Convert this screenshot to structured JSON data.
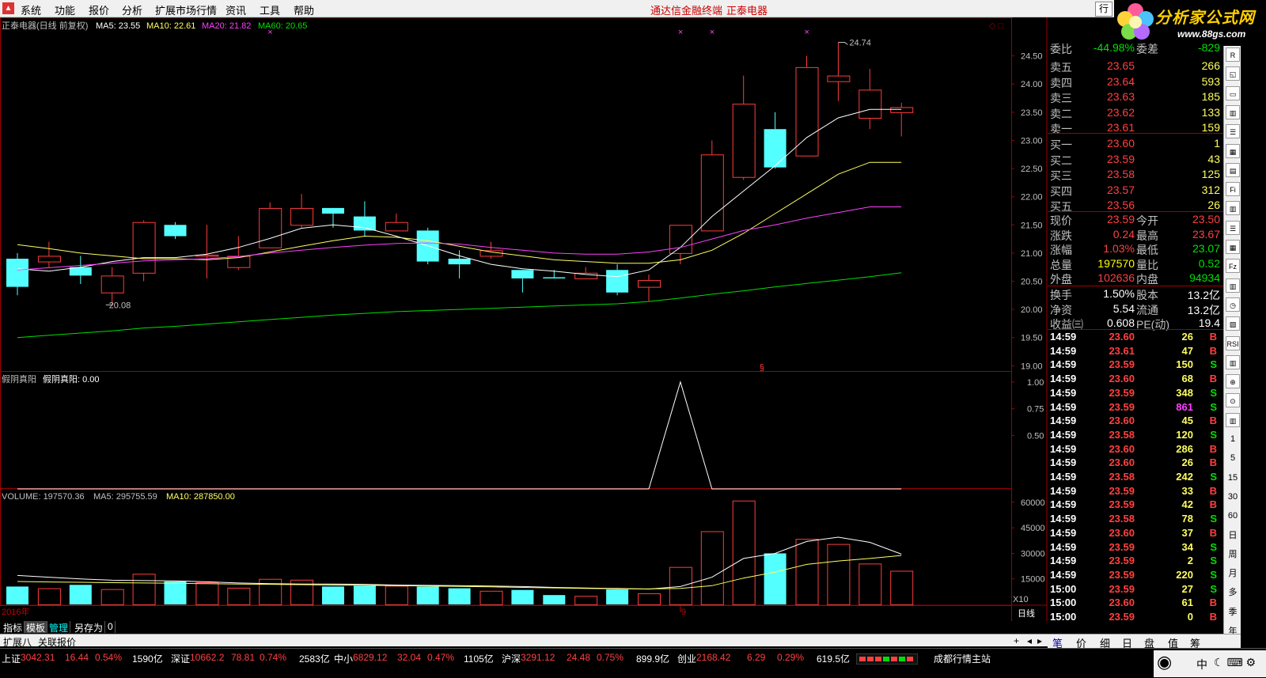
{
  "menu": {
    "items": [
      "系统",
      "功能",
      "报价",
      "分析",
      "扩展市场行情",
      "资讯",
      "工具",
      "帮助"
    ],
    "center_title": "通达信金融终端",
    "center_stock": "正泰电器",
    "win_tab": "行"
  },
  "brand": {
    "name": "分析家公式网",
    "url": "www.88gs.com"
  },
  "main_legend": {
    "title": "正泰电器(日线 前复权)",
    "ma5": "MA5: 23.55",
    "ma10": "MA10: 22.61",
    "ma20": "MA20: 21.82",
    "ma60": "MA60: 20.65"
  },
  "price_axis": [
    "24.50",
    "24.00",
    "23.50",
    "23.00",
    "22.50",
    "22.00",
    "21.50",
    "21.00",
    "20.50",
    "20.00",
    "19.50",
    "19.00"
  ],
  "annotations": {
    "high": "24.74",
    "low": "20.08"
  },
  "indicator": {
    "title": "假阴真阳",
    "label": "假阴真阳: 0.00",
    "axis": [
      "1.00",
      "0.75",
      "0.50"
    ]
  },
  "volume_legend": {
    "volume": "VOLUME: 197570.36",
    "ma5": "MA5: 295755.59",
    "ma10": "MA10: 287850.00"
  },
  "volume_axis": [
    "60000",
    "45000",
    "30000",
    "15000"
  ],
  "volume_unit": "X10",
  "date_axis": {
    "year": "2016年",
    "month": "9",
    "period": "日线"
  },
  "chart_data": {
    "type": "candlestick",
    "ohlc": [
      [
        20.9,
        20.4,
        21.0,
        20.25
      ],
      [
        20.85,
        20.95,
        21.2,
        20.75
      ],
      [
        20.75,
        20.6,
        20.95,
        20.45
      ],
      [
        20.3,
        20.6,
        20.75,
        20.08
      ],
      [
        20.65,
        21.55,
        21.58,
        20.5
      ],
      [
        21.5,
        21.3,
        21.55,
        21.25
      ],
      [
        20.95,
        20.97,
        21.5,
        20.55
      ],
      [
        20.75,
        20.95,
        21.3,
        20.7
      ],
      [
        21.1,
        21.8,
        21.9,
        21.1
      ],
      [
        21.5,
        21.8,
        22.05,
        21.45
      ],
      [
        21.8,
        21.7,
        21.78,
        21.45
      ],
      [
        21.65,
        21.4,
        21.92,
        21.3
      ],
      [
        21.4,
        21.55,
        21.7,
        21.4
      ],
      [
        21.4,
        20.85,
        21.45,
        20.8
      ],
      [
        20.9,
        20.8,
        21.05,
        20.55
      ],
      [
        20.95,
        21.05,
        21.2,
        20.9
      ],
      [
        20.7,
        20.55,
        20.7,
        20.3
      ],
      [
        20.57,
        20.55,
        20.7,
        20.55
      ],
      [
        20.55,
        20.65,
        20.75,
        20.55
      ],
      [
        20.7,
        20.3,
        20.8,
        20.25
      ],
      [
        20.4,
        20.52,
        20.62,
        20.15
      ],
      [
        21.0,
        21.5,
        21.5,
        20.8
      ],
      [
        21.4,
        22.75,
        23.0,
        21.4
      ],
      [
        22.35,
        23.65,
        24.15,
        22.3
      ],
      [
        23.2,
        22.52,
        23.5,
        22.5
      ],
      [
        22.73,
        24.3,
        24.5,
        22.73
      ],
      [
        24.05,
        24.15,
        24.74,
        23.7
      ],
      [
        23.4,
        23.9,
        24.27,
        23.2
      ],
      [
        23.5,
        23.59,
        23.67,
        23.07
      ]
    ],
    "ma5": [
      20.72,
      20.68,
      20.75,
      20.85,
      20.92,
      20.92,
      20.98,
      21.1,
      21.26,
      21.44,
      21.5,
      21.45,
      21.3,
      21.13,
      20.95,
      20.8,
      20.72,
      20.68,
      20.62,
      20.58,
      20.7,
      21.1,
      21.65,
      22.1,
      22.55,
      23.05,
      23.4,
      23.55,
      23.55
    ],
    "ma10": [
      21.15,
      21.08,
      21.0,
      20.95,
      20.9,
      20.9,
      20.88,
      20.92,
      21.02,
      21.12,
      21.22,
      21.3,
      21.28,
      21.22,
      21.12,
      21.02,
      20.95,
      20.88,
      20.85,
      20.82,
      20.82,
      20.88,
      21.05,
      21.35,
      21.7,
      22.05,
      22.4,
      22.61,
      22.61
    ],
    "ma20": [
      20.7,
      20.74,
      20.78,
      20.82,
      20.86,
      20.88,
      20.9,
      20.94,
      21.0,
      21.05,
      21.1,
      21.14,
      21.17,
      21.18,
      21.16,
      21.1,
      21.05,
      21.0,
      20.98,
      20.98,
      21.02,
      21.1,
      21.25,
      21.4,
      21.5,
      21.62,
      21.72,
      21.82,
      21.82
    ],
    "ma60": [
      19.5,
      19.54,
      19.58,
      19.62,
      19.67,
      19.7,
      19.74,
      19.78,
      19.82,
      19.86,
      19.9,
      19.93,
      19.96,
      19.98,
      20.0,
      20.02,
      20.04,
      20.06,
      20.08,
      20.1,
      20.14,
      20.2,
      20.27,
      20.33,
      20.4,
      20.46,
      20.52,
      20.58,
      20.65
    ],
    "indicator": [
      0,
      0,
      0,
      0,
      0,
      0,
      0,
      0,
      0,
      0,
      0,
      0,
      0,
      0,
      0,
      0,
      0,
      0,
      0,
      0,
      0,
      1,
      0,
      0,
      0,
      0,
      0,
      0,
      0
    ],
    "volume": [
      10500,
      9500,
      11500,
      9000,
      18000,
      13500,
      13000,
      9800,
      15000,
      14500,
      10500,
      11000,
      11000,
      10500,
      9500,
      8000,
      8500,
      5500,
      5000,
      8800,
      6500,
      22000,
      43000,
      61000,
      30000,
      38500,
      35500,
      24000,
      19757
    ],
    "vol_ma5": [
      17000,
      16000,
      15000,
      14200,
      14000,
      13800,
      13300,
      12600,
      12200,
      12000,
      12000,
      11800,
      11400,
      11200,
      11000,
      10800,
      10500,
      10000,
      9600,
      9400,
      9000,
      10500,
      16000,
      27000,
      30000,
      37000,
      39500,
      36500,
      29575
    ],
    "vol_ma10": [
      13500,
      13200,
      13000,
      12800,
      12600,
      12400,
      12200,
      12000,
      11800,
      11600,
      11400,
      11200,
      11000,
      10800,
      10600,
      10300,
      10000,
      9700,
      9400,
      9200,
      9100,
      9400,
      11000,
      15500,
      19000,
      23500,
      25500,
      27000,
      28785
    ],
    "price_range": [
      18.92,
      24.86
    ],
    "vol_range": [
      0,
      66000
    ]
  },
  "quote": {
    "wei": {
      "label": "委比",
      "value": "-44.98%",
      "label2": "委差",
      "value2": "-829"
    },
    "sells": [
      {
        "label": "卖五",
        "price": "23.65",
        "vol": "266"
      },
      {
        "label": "卖四",
        "price": "23.64",
        "vol": "593"
      },
      {
        "label": "卖三",
        "price": "23.63",
        "vol": "185"
      },
      {
        "label": "卖二",
        "price": "23.62",
        "vol": "133"
      },
      {
        "label": "卖一",
        "price": "23.61",
        "vol": "159"
      }
    ],
    "buys": [
      {
        "label": "买一",
        "price": "23.60",
        "vol": "1"
      },
      {
        "label": "买二",
        "price": "23.59",
        "vol": "43"
      },
      {
        "label": "买三",
        "price": "23.58",
        "vol": "125"
      },
      {
        "label": "买四",
        "price": "23.57",
        "vol": "312"
      },
      {
        "label": "买五",
        "price": "23.56",
        "vol": "26"
      }
    ],
    "stats": [
      {
        "l1": "现价",
        "v1": "23.59",
        "c1": "#ff4040",
        "l2": "今开",
        "v2": "23.50",
        "c2": "#ff4040"
      },
      {
        "l1": "涨跌",
        "v1": "0.24",
        "c1": "#ff4040",
        "l2": "最高",
        "v2": "23.67",
        "c2": "#ff4040"
      },
      {
        "l1": "涨幅",
        "v1": "1.03%",
        "c1": "#ff4040",
        "l2": "最低",
        "v2": "23.07",
        "c2": "#00e000"
      },
      {
        "l1": "总量",
        "v1": "197570",
        "c1": "#ffff00",
        "l2": "量比",
        "v2": "0.52",
        "c2": "#00e000"
      },
      {
        "l1": "外盘",
        "v1": "102636",
        "c1": "#ff4040",
        "l2": "内盘",
        "v2": "94934",
        "c2": "#00e000"
      }
    ],
    "fund": [
      {
        "l1": "换手",
        "v1": "1.50%",
        "l2": "股本",
        "v2": "13.2亿"
      },
      {
        "l1": "净资",
        "v1": "5.54",
        "l2": "流通",
        "v2": "13.2亿"
      },
      {
        "l1": "收益㈢",
        "v1": "0.608",
        "l2": "PE(动)",
        "v2": "19.4"
      }
    ]
  },
  "ticks": [
    {
      "t": "14:59",
      "p": "23.60",
      "v": "26",
      "d": "B"
    },
    {
      "t": "14:59",
      "p": "23.61",
      "v": "47",
      "d": "B"
    },
    {
      "t": "14:59",
      "p": "23.59",
      "v": "150",
      "d": "S"
    },
    {
      "t": "14:59",
      "p": "23.60",
      "v": "68",
      "d": "B"
    },
    {
      "t": "14:59",
      "p": "23.59",
      "v": "348",
      "d": "S"
    },
    {
      "t": "14:59",
      "p": "23.59",
      "v": "861",
      "d": "S"
    },
    {
      "t": "14:59",
      "p": "23.60",
      "v": "45",
      "d": "B"
    },
    {
      "t": "14:59",
      "p": "23.58",
      "v": "120",
      "d": "S"
    },
    {
      "t": "14:59",
      "p": "23.60",
      "v": "286",
      "d": "B"
    },
    {
      "t": "14:59",
      "p": "23.60",
      "v": "26",
      "d": "B"
    },
    {
      "t": "14:59",
      "p": "23.58",
      "v": "242",
      "d": "S"
    },
    {
      "t": "14:59",
      "p": "23.59",
      "v": "33",
      "d": "B"
    },
    {
      "t": "14:59",
      "p": "23.59",
      "v": "42",
      "d": "B"
    },
    {
      "t": "14:59",
      "p": "23.58",
      "v": "78",
      "d": "S"
    },
    {
      "t": "14:59",
      "p": "23.60",
      "v": "37",
      "d": "B"
    },
    {
      "t": "14:59",
      "p": "23.59",
      "v": "34",
      "d": "S"
    },
    {
      "t": "14:59",
      "p": "23.59",
      "v": "2",
      "d": "S"
    },
    {
      "t": "14:59",
      "p": "23.59",
      "v": "220",
      "d": "S"
    },
    {
      "t": "15:00",
      "p": "23.59",
      "v": "27",
      "d": "S"
    },
    {
      "t": "15:00",
      "p": "23.60",
      "v": "61",
      "d": "B"
    },
    {
      "t": "15:00",
      "p": "23.59",
      "v": "0",
      "d": "B"
    }
  ],
  "right_tools": [
    "R",
    "◱",
    "▭",
    "▥",
    "☰",
    "▦",
    "▤",
    "Fi",
    "▥",
    "☰",
    "▦",
    "Fz",
    "▥",
    "◷",
    "▨",
    "RSI",
    "▥",
    "⊕",
    "⊙",
    "▥",
    "1",
    "5",
    "15",
    "30",
    "60",
    "日",
    "周",
    "月",
    "多",
    "季",
    "年"
  ],
  "bottom_tabs": [
    "指标",
    "模板",
    "管理",
    "另存为",
    "0"
  ],
  "ext_tabs": [
    "扩展八",
    "关联报价"
  ],
  "ext_controls": [
    "+",
    "◂",
    "▸"
  ],
  "quote_tabs": [
    "笔",
    "价",
    "细",
    "日",
    "盘",
    "值",
    "筹"
  ],
  "status": {
    "sh": {
      "name": "上证",
      "idx": "3042.31",
      "chg": "16.44",
      "pct": "0.54%",
      "amt": "1590亿"
    },
    "sz": {
      "name": "深证",
      "idx": "10662.2",
      "chg": "78.81",
      "pct": "0.74%",
      "amt": "2583亿"
    },
    "zx": {
      "name": "中小",
      "idx": "6829.12",
      "chg": "32.04",
      "pct": "0.47%",
      "amt": "1105亿"
    },
    "hs": {
      "name": "沪深",
      "idx": "3291.12",
      "chg": "24.48",
      "pct": "0.75%",
      "amt": "899.9亿"
    },
    "cy": {
      "name": "创业",
      "idx": "2168.42",
      "chg": "6.29",
      "pct": "0.29%",
      "amt": "619.5亿"
    },
    "site": "成都行情主站",
    "ime": "中"
  }
}
